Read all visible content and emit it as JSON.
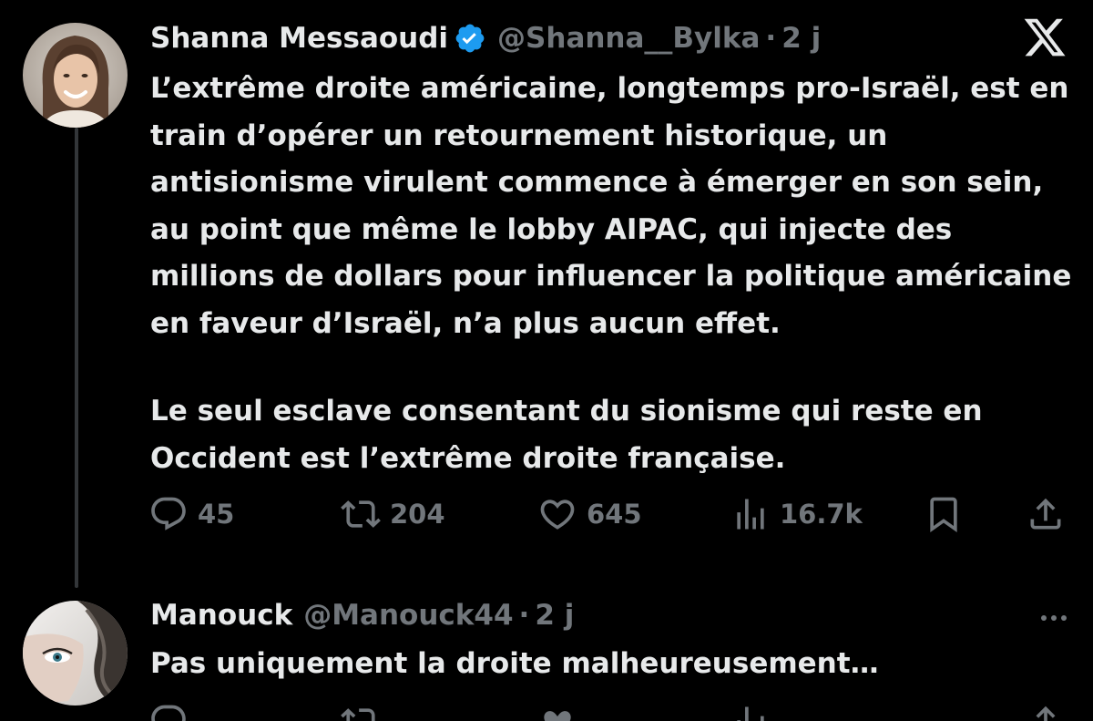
{
  "tweet": {
    "author_name": "Shanna Messaoudi",
    "handle": "@Shanna__Bylka",
    "separator": "·",
    "time": "2 j",
    "verified": true,
    "paragraph_1": "L’extrême droite américaine, longtemps pro-Israël, est en train d’opérer un retournement historique, un antisionisme virulent commence à émerger en son sein, au point que même le lobby AIPAC, qui injecte des millions de dollars pour influencer la politique américaine en faveur d’Israël, n’a plus aucun effet.",
    "paragraph_2": "Le seul esclave consentant du sionisme qui reste en Occident est l’extrême droite française.",
    "replies": "45",
    "reposts": "204",
    "likes": "645",
    "views": "16.7k"
  },
  "reply": {
    "author_name": "Manouck",
    "handle": "@Manouck44",
    "separator": "·",
    "time": "2 j",
    "text": "Pas uniquement la droite malheureusement…"
  },
  "icons": {
    "logo": "x-logo-icon",
    "verified": "verified-badge-icon",
    "reply": "reply-bubble-icon",
    "repost": "repost-arrows-icon",
    "like": "heart-icon",
    "views": "bar-chart-icon",
    "bookmark": "bookmark-icon",
    "share": "share-upload-icon",
    "more": "more-dots-icon"
  },
  "colors": {
    "background": "#000000",
    "text_primary": "#e7e9ea",
    "text_secondary": "#71767b",
    "verified_blue": "#1d9bf0",
    "thread_line": "#333639"
  }
}
